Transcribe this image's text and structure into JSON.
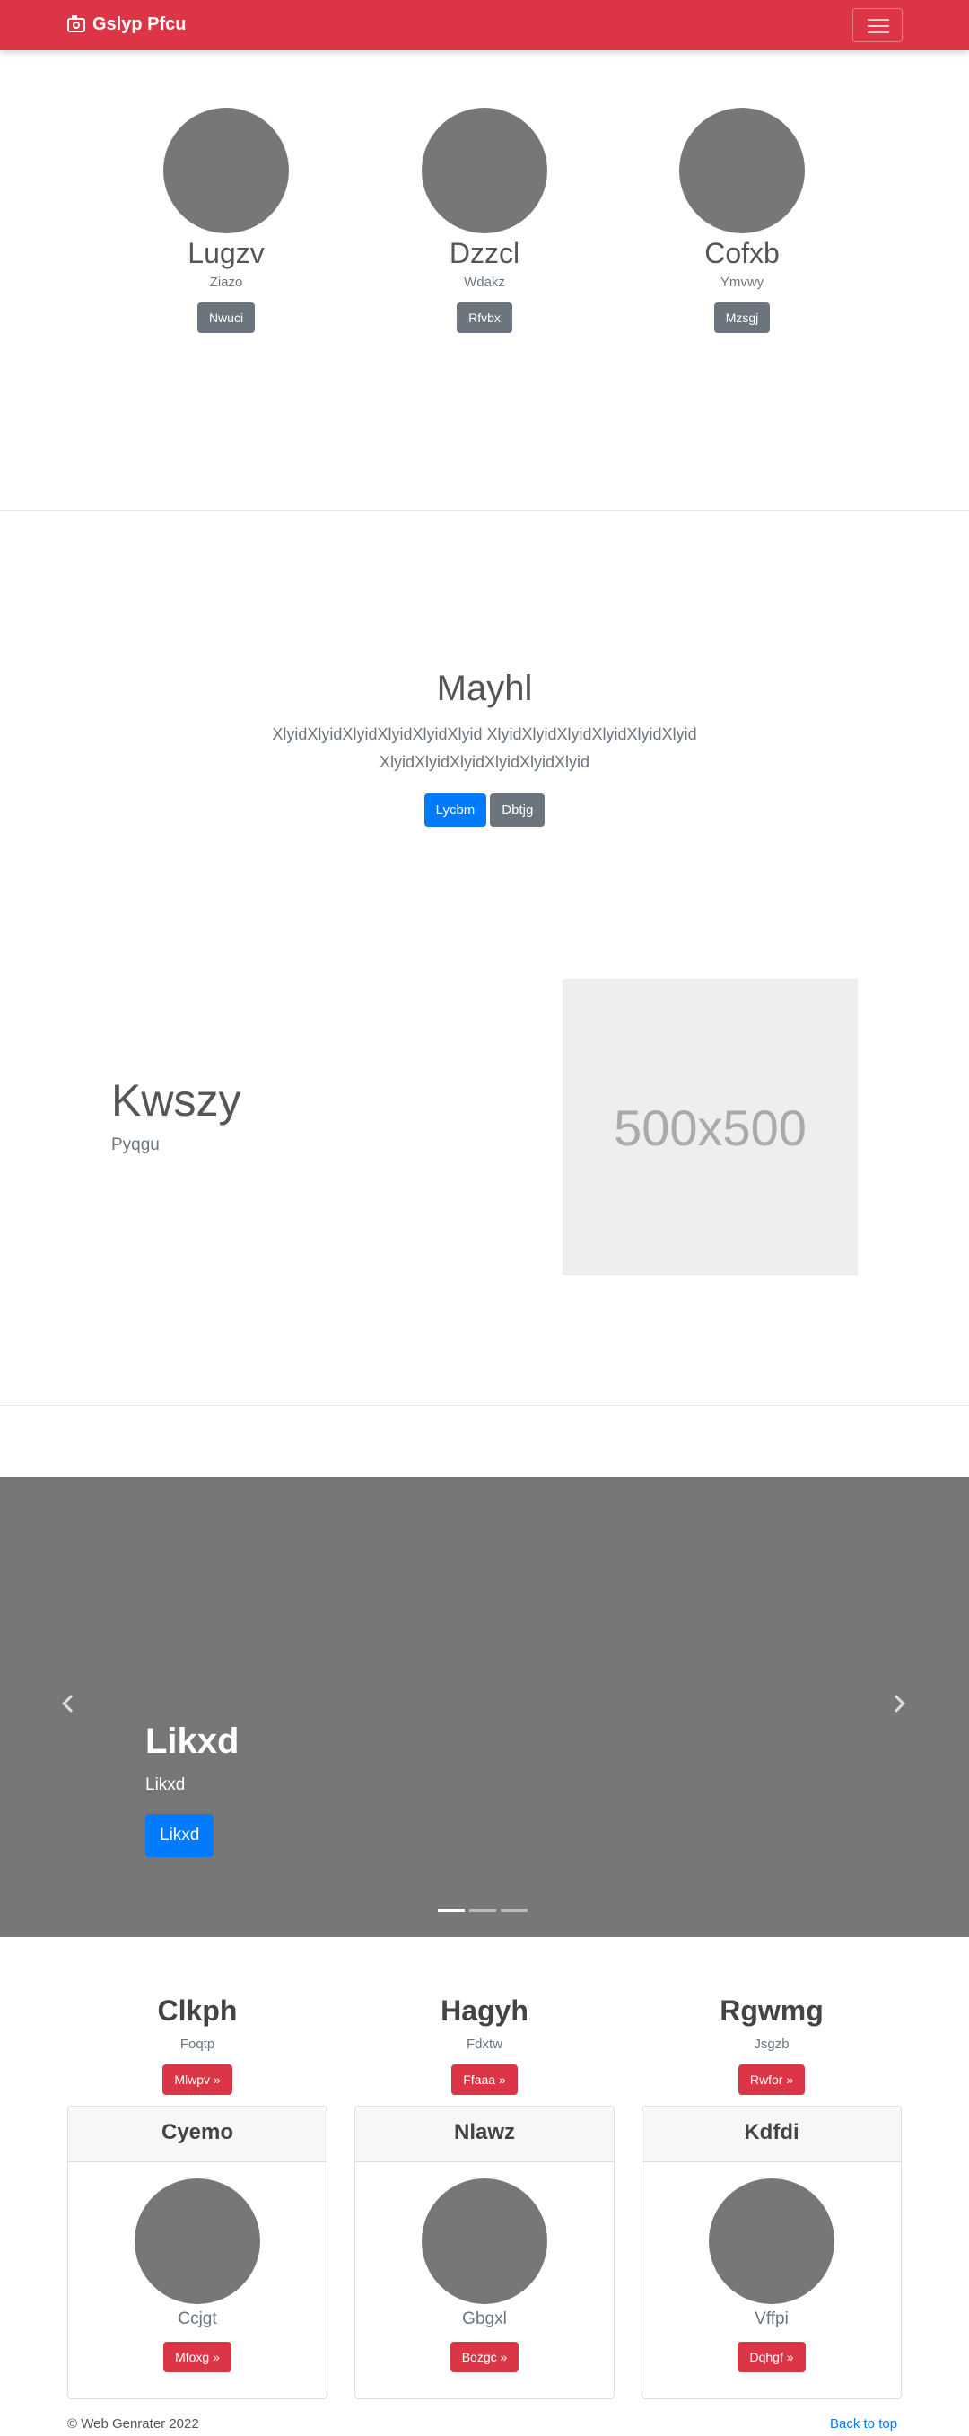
{
  "navbar": {
    "brand": "Gslyp Pfcu",
    "brand_icon": "camera-icon",
    "color": "#dc3545"
  },
  "people": [
    {
      "name": "Lugzv",
      "sub": "Ziazo",
      "button": "Nwuci"
    },
    {
      "name": "Dzzcl",
      "sub": "Wdakz",
      "button": "Rfvbx"
    },
    {
      "name": "Cofxb",
      "sub": "Ymvwy",
      "button": "Mzsgj"
    }
  ],
  "hero": {
    "title": "Mayhl",
    "text": "XlyidXlyidXlyidXlyidXlyidXlyid XlyidXlyidXlyidXlyidXlyidXlyid XlyidXlyidXlyidXlyidXlyidXlyid",
    "primary_button": "Lycbm",
    "secondary_button": "Dbtjg"
  },
  "feature": {
    "title": "Kwszy",
    "subtitle": "Pyqgu",
    "image_label": "500x500"
  },
  "carousel": {
    "title": "Likxd",
    "subtitle": "Likxd",
    "button": "Likxd",
    "slides": 3,
    "active": 0
  },
  "columns": [
    {
      "heading": "Clkph",
      "sub": "Foqtp",
      "button": "Mlwpv »"
    },
    {
      "heading": "Hagyh",
      "sub": "Fdxtw",
      "button": "Ffaaa »"
    },
    {
      "heading": "Rgwmg",
      "sub": "Jsgzb",
      "button": "Rwfor »"
    }
  ],
  "cards": [
    {
      "header": "Cyemo",
      "sub": "Ccjgt",
      "button": "Mfoxg »"
    },
    {
      "header": "Nlawz",
      "sub": "Gbgxl",
      "button": "Bozgc »"
    },
    {
      "header": "Kdfdi",
      "sub": "Vffpi",
      "button": "Dqhgf »"
    }
  ],
  "footer": {
    "copyright": "© Web Genrater 2022",
    "back_to_top": "Back to top"
  }
}
